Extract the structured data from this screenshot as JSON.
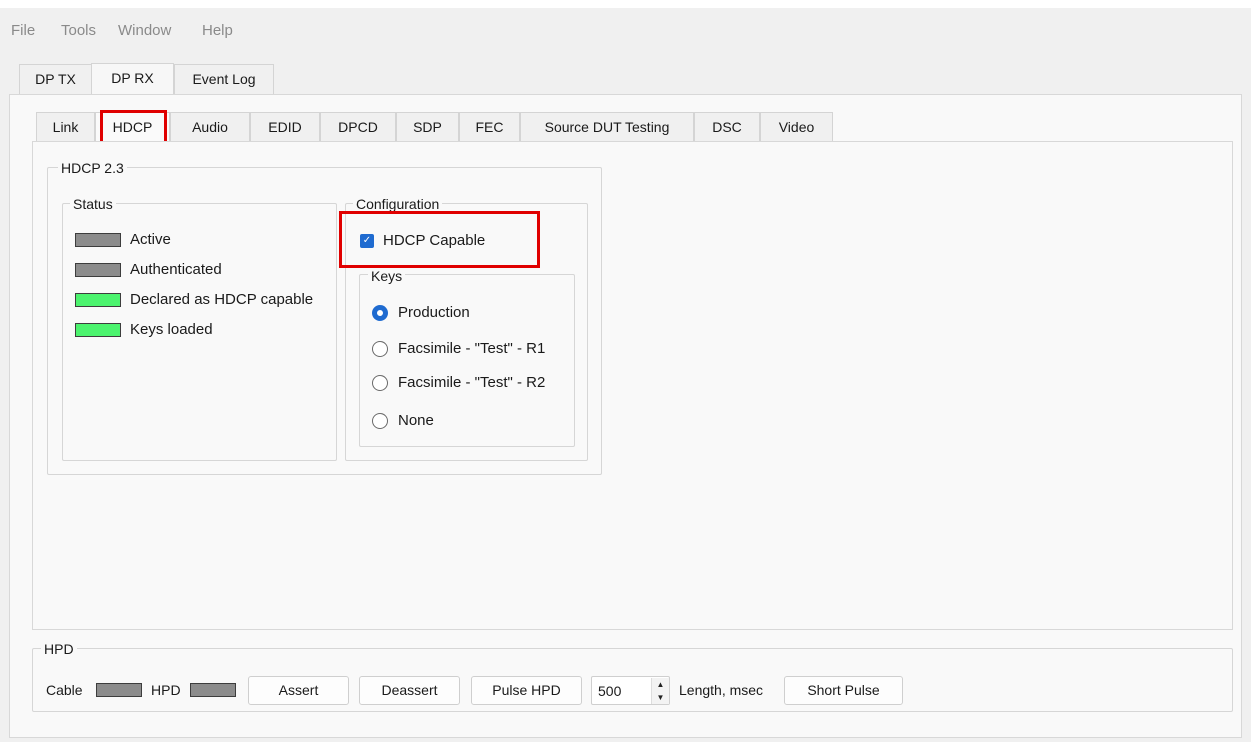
{
  "menu": [
    "File",
    "Tools",
    "Window",
    "Help"
  ],
  "outer_tabs": [
    "DP TX",
    "DP RX",
    "Event Log"
  ],
  "inner_tabs": [
    "Link",
    "HDCP",
    "Audio",
    "EDID",
    "DPCD",
    "SDP",
    "FEC",
    "Source DUT Testing",
    "DSC",
    "Video"
  ],
  "hdcp": {
    "group_title": "HDCP 2.3",
    "status": {
      "title": "Status",
      "items": [
        {
          "label": "Active",
          "state": "gray"
        },
        {
          "label": "Authenticated",
          "state": "gray"
        },
        {
          "label": "Declared as HDCP capable",
          "state": "green"
        },
        {
          "label": "Keys loaded",
          "state": "green"
        }
      ]
    },
    "configuration": {
      "title": "Configuration",
      "capable_label": "HDCP Capable",
      "capable_checked": true,
      "keys": {
        "title": "Keys",
        "options": [
          "Production",
          "Facsimile - \"Test\" - R1",
          "Facsimile - \"Test\" - R2",
          "None"
        ],
        "selected": "Production"
      }
    }
  },
  "hpd": {
    "title": "HPD",
    "cable_label": "Cable",
    "hpd_label": "HPD",
    "assert_label": "Assert",
    "deassert_label": "Deassert",
    "pulse_label": "Pulse HPD",
    "length_value": "500",
    "length_label": "Length, msec",
    "short_pulse_label": "Short Pulse"
  },
  "colors": {
    "led_gray": "#8c8c8c",
    "led_green": "#4cf36e",
    "accent": "#1f6bd0",
    "highlight": "#e00000"
  }
}
